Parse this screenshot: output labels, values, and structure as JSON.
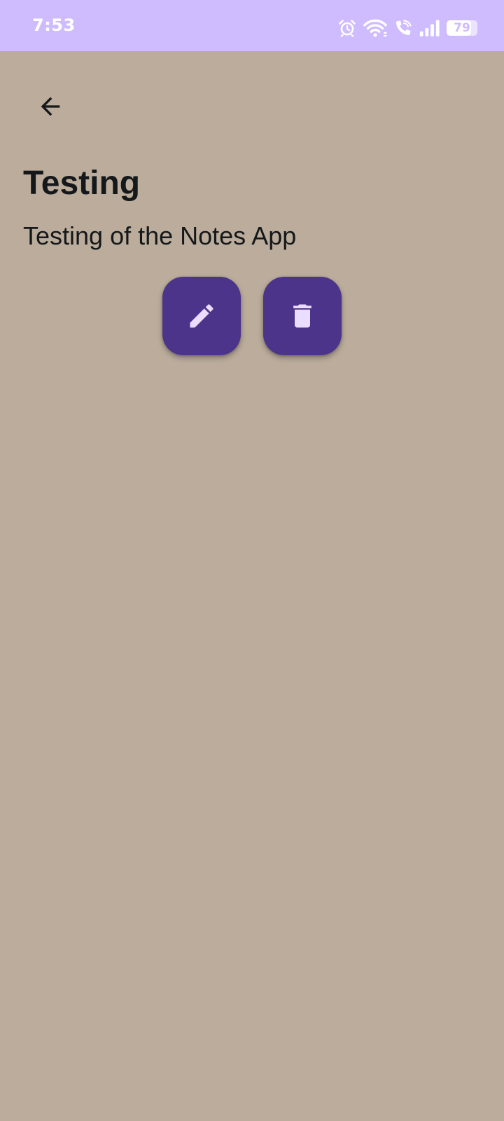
{
  "status_bar": {
    "time": "7:53",
    "battery_percent": "79",
    "battery_level": 0.79,
    "icons": [
      "alarm-icon",
      "wifi-icon",
      "wifi-calling-icon",
      "signal-icon",
      "battery-icon"
    ]
  },
  "toolbar": {
    "back_icon": "arrow-left-icon"
  },
  "note": {
    "title": "Testing",
    "body": "Testing of the Notes App"
  },
  "actions": {
    "edit_icon": "pencil-icon",
    "delete_icon": "trash-icon"
  },
  "colors": {
    "background": "#bbac9b",
    "status_bar": "#cfbcff",
    "button": "#4d348b",
    "button_icon": "#eaddff",
    "text": "#15181a"
  }
}
